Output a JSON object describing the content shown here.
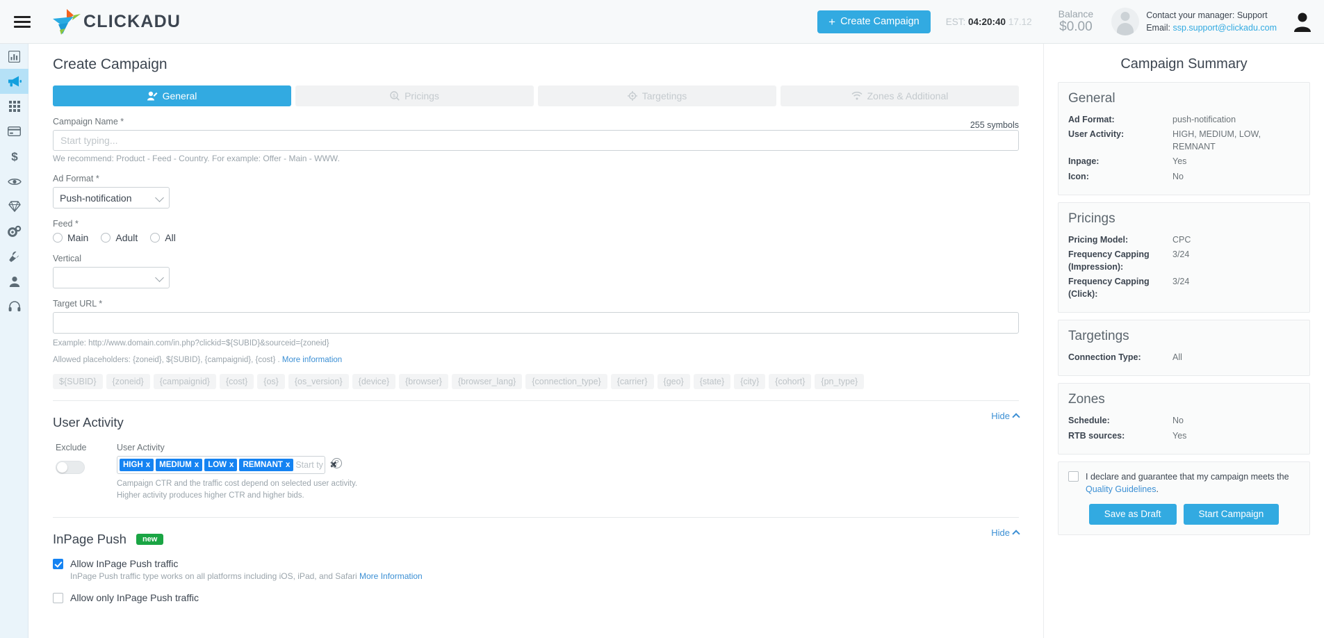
{
  "header": {
    "brand": "CLICKADU",
    "create_button": "Create Campaign",
    "create_plus": "+",
    "est_label": "EST:",
    "est_time": "04:20:40",
    "est_date": "17.12",
    "balance_label": "Balance",
    "balance_amount": "$0.00",
    "manager_line": "Contact your manager: Support",
    "email_label": "Email:",
    "email_value": "ssp.support@clickadu.com"
  },
  "rail": {
    "items": [
      {
        "name": "statistics",
        "icon": "bar-chart-icon",
        "active": false
      },
      {
        "name": "campaigns",
        "icon": "megaphone-icon",
        "active": true
      },
      {
        "name": "apps",
        "icon": "grid-icon",
        "active": false
      },
      {
        "name": "billing",
        "icon": "credit-card-icon",
        "active": false
      },
      {
        "name": "finance",
        "icon": "dollar-icon",
        "active": false
      },
      {
        "name": "preview",
        "icon": "eye-icon",
        "active": false
      },
      {
        "name": "premium",
        "icon": "diamond-icon",
        "active": false
      },
      {
        "name": "settings",
        "icon": "gears-icon",
        "active": false
      },
      {
        "name": "tools",
        "icon": "wrench-icon",
        "active": false
      },
      {
        "name": "profile",
        "icon": "person-icon",
        "active": false
      },
      {
        "name": "support",
        "icon": "headset-icon",
        "active": false
      }
    ]
  },
  "page": {
    "title": "Create Campaign"
  },
  "tabs": [
    {
      "label": "General",
      "icon": "user-edit-icon",
      "active": true
    },
    {
      "label": "Pricings",
      "icon": "magnifier-dollar-icon",
      "active": false
    },
    {
      "label": "Targetings",
      "icon": "crosshair-icon",
      "active": false
    },
    {
      "label": "Zones & Additional",
      "icon": "wifi-icon",
      "active": false
    }
  ],
  "general": {
    "campaign_name_label": "Campaign Name *",
    "symbols_counter": "255 symbols",
    "campaign_name_placeholder": "Start typing...",
    "campaign_name_value": "",
    "campaign_name_hint": "We recommend: Product - Feed - Country. For example: Offer - Main - WWW.",
    "ad_format_label": "Ad Format  *",
    "ad_format_value": "Push-notification",
    "feed_label": "Feed *",
    "feed_options": [
      "Main",
      "Adult",
      "All"
    ],
    "vertical_label": "Vertical",
    "vertical_value": "",
    "target_url_label": "Target URL  *",
    "target_url_value": "",
    "example_line": "Example: http://www.domain.com/in.php?clickid=${SUBID}&sourceid={zoneid}",
    "allowed_line": "Allowed placeholders: {zoneid}, ${SUBID}, {campaignid}, {cost} .",
    "more_information": "More information",
    "placeholder_chips": [
      "${SUBID}",
      "{zoneid}",
      "{campaignid}",
      "{cost}",
      "{os}",
      "{os_version}",
      "{device}",
      "{browser}",
      "{browser_lang}",
      "{connection_type}",
      "{carrier}",
      "{geo}",
      "{state}",
      "{city}",
      "{cohort}",
      "{pn_type}"
    ]
  },
  "user_activity": {
    "section_title": "User Activity",
    "hide_label": "Hide",
    "exclude_label": "Exclude",
    "exclude_on": false,
    "field_label": "User Activity",
    "tags": [
      "HIGH",
      "MEDIUM",
      "LOW",
      "REMNANT"
    ],
    "tag_remove_glyph": "x",
    "input_placeholder": "Start typing...",
    "clear_glyph": "✖",
    "help_glyph": "?",
    "note_line1": "Campaign CTR and the traffic cost depend on selected user activity.",
    "note_line2": "Higher activity produces higher CTR and higher bids."
  },
  "inpage_push": {
    "section_title": "InPage Push",
    "badge": "new",
    "hide_label": "Hide",
    "allow_label": "Allow InPage Push traffic",
    "allow_checked": true,
    "allow_sub": "InPage Push traffic type works on all platforms including iOS, iPad, and Safari",
    "allow_sub_link": "More Information",
    "only_label": "Allow only InPage Push traffic",
    "only_checked": false
  },
  "summary": {
    "title": "Campaign Summary",
    "cards": [
      {
        "heading": "General",
        "rows": [
          {
            "key": "Ad Format:",
            "value": "push-notification"
          },
          {
            "key": "User Activity:",
            "value": "HIGH, MEDIUM, LOW, REMNANT"
          },
          {
            "key": "Inpage:",
            "value": "Yes"
          },
          {
            "key": "Icon:",
            "value": "No"
          }
        ]
      },
      {
        "heading": "Pricings",
        "rows": [
          {
            "key": "Pricing Model:",
            "value": "CPC"
          },
          {
            "key": "Frequency Capping (Impression):",
            "value": "3/24"
          },
          {
            "key": "Frequency Capping (Click):",
            "value": "3/24"
          }
        ]
      },
      {
        "heading": "Targetings",
        "rows": [
          {
            "key": "Connection Type:",
            "value": "All"
          }
        ]
      },
      {
        "heading": "Zones",
        "rows": [
          {
            "key": "Schedule:",
            "value": "No"
          },
          {
            "key": "RTB sources:",
            "value": "Yes"
          }
        ]
      }
    ],
    "declare_text": "I declare and guarantee that my campaign meets the",
    "declare_link": "Quality Guidelines",
    "declare_period": ".",
    "declare_checked": false,
    "save_draft": "Save as Draft",
    "start_campaign": "Start Campaign"
  },
  "colors": {
    "accent": "#32aae1",
    "tag_blue": "#1583f2",
    "link": "#3b8fd4",
    "green_badge": "#1aa544",
    "rail_bg": "#eaf4fa",
    "rail_active": "#b5e1f7"
  }
}
